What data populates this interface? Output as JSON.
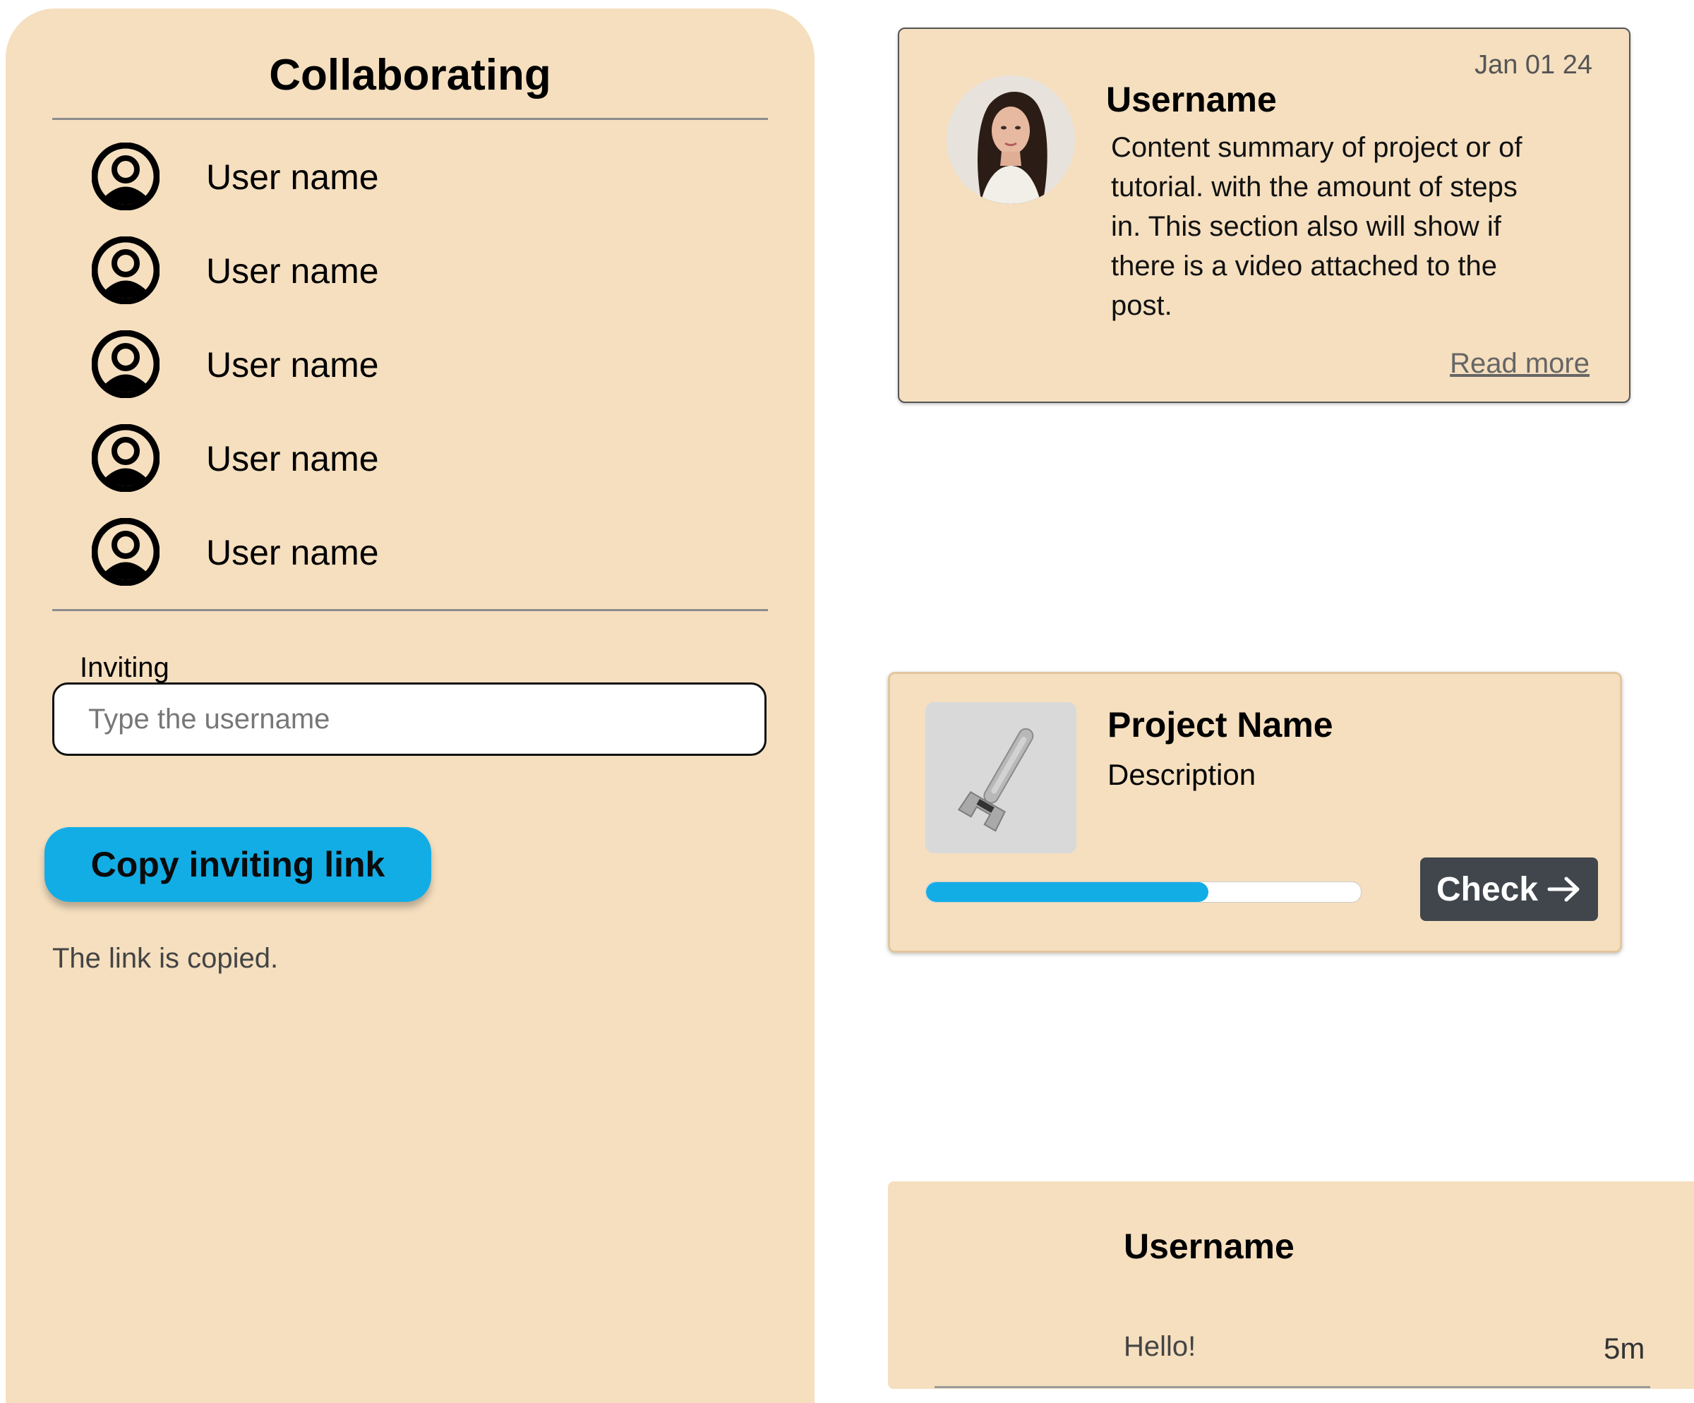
{
  "collaborating": {
    "title": "Collaborating",
    "users": [
      {
        "name": "User name",
        "icon": "user-circle-icon"
      },
      {
        "name": "User name",
        "icon": "user-circle-icon"
      },
      {
        "name": "User name",
        "icon": "user-circle-icon"
      },
      {
        "name": "User name",
        "icon": "user-circle-icon"
      },
      {
        "name": "User name",
        "icon": "user-circle-icon"
      }
    ],
    "invite_label": "Inviting",
    "invite_placeholder": "Type the username",
    "invite_value": "",
    "copy_button_label": "Copy inviting link",
    "copied_status": "The link is copied."
  },
  "post_card": {
    "date": "Jan 01 24",
    "username": "Username",
    "summary": "Content summary of project or of tutorial. with the amount of steps in. This section also will show if there is a video attached to the post.",
    "read_more": "Read more"
  },
  "project_card": {
    "name": "Project Name",
    "description": "Description",
    "progress": 0.65,
    "check_label": "Check",
    "check_icon": "arrow-right-icon"
  },
  "message_card": {
    "username": "Username",
    "message": "Hello!",
    "time": "5m"
  },
  "colors": {
    "panel_bg": "#f5dfbf",
    "accent_blue": "#13ade6",
    "dark_button": "#40464c"
  }
}
